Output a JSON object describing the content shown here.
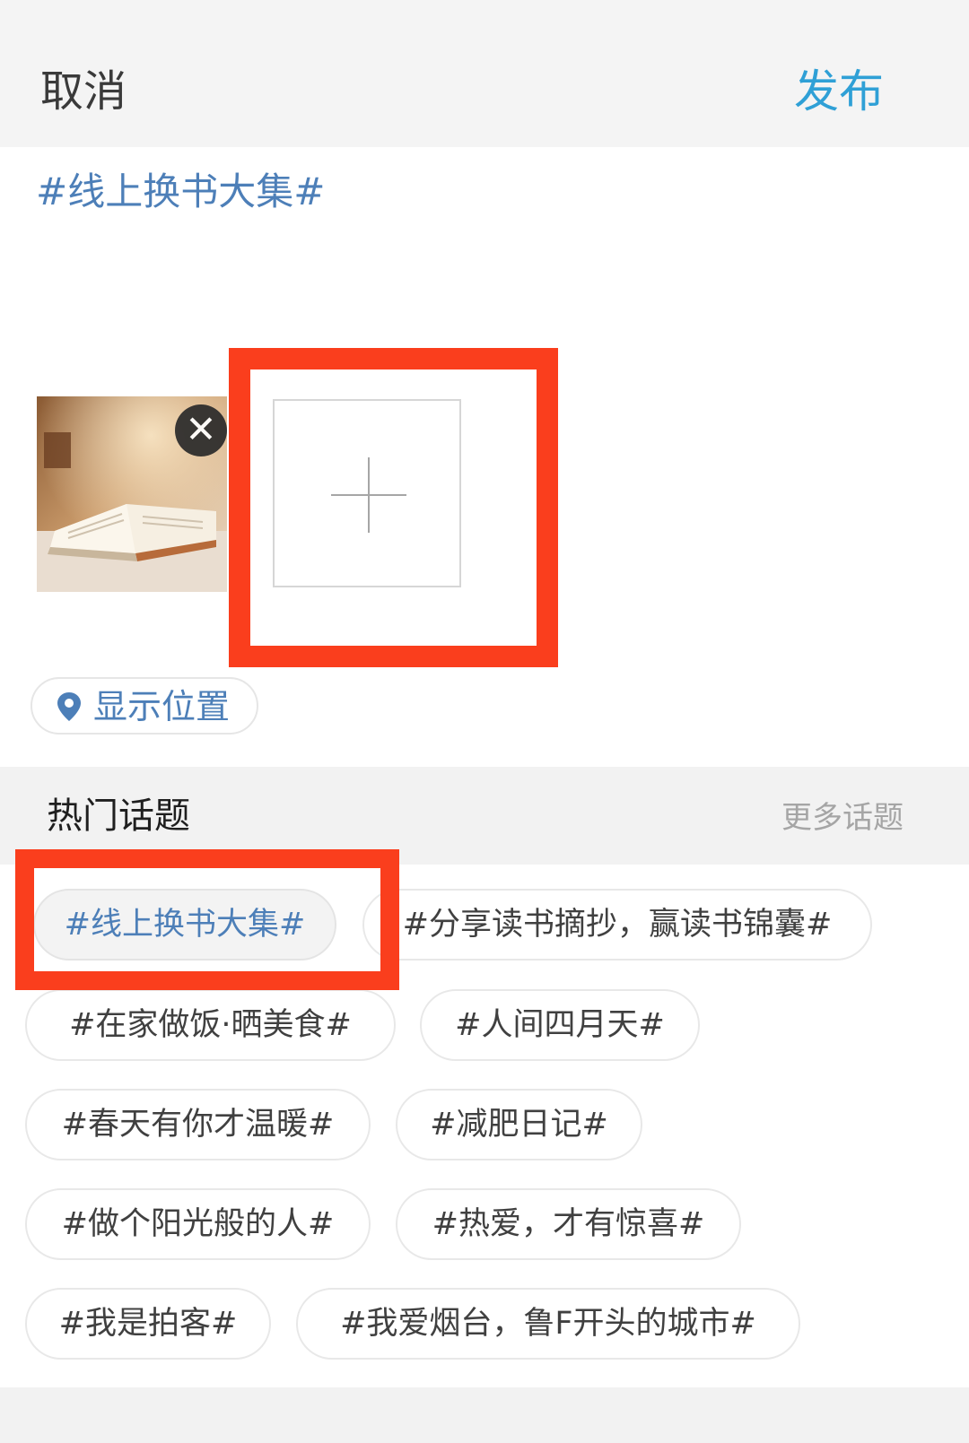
{
  "header": {
    "cancel_label": "取消",
    "publish_label": "发布"
  },
  "post": {
    "text": "#线上换书大集#",
    "add_image_icon": "plus-icon",
    "remove_image_icon": "close-icon"
  },
  "location": {
    "icon": "location-pin-icon",
    "label": "显示位置"
  },
  "hot_topics": {
    "title": "热门话题",
    "more_label": "更多话题",
    "items": [
      "#线上换书大集#",
      "#分享读书摘抄，赢读书锦囊#",
      "#在家做饭·晒美食#",
      "#人间四月天#",
      "#春天有你才温暖#",
      "#减肥日记#",
      "#做个阳光般的人#",
      "#热爱，才有惊喜#",
      "#我是拍客#",
      "#我爱烟台，鲁F开头的城市#"
    ]
  },
  "colors": {
    "accent_blue": "#2fa0d6",
    "topic_blue": "#4d7fb8",
    "highlight_red": "#fa3e1d"
  }
}
